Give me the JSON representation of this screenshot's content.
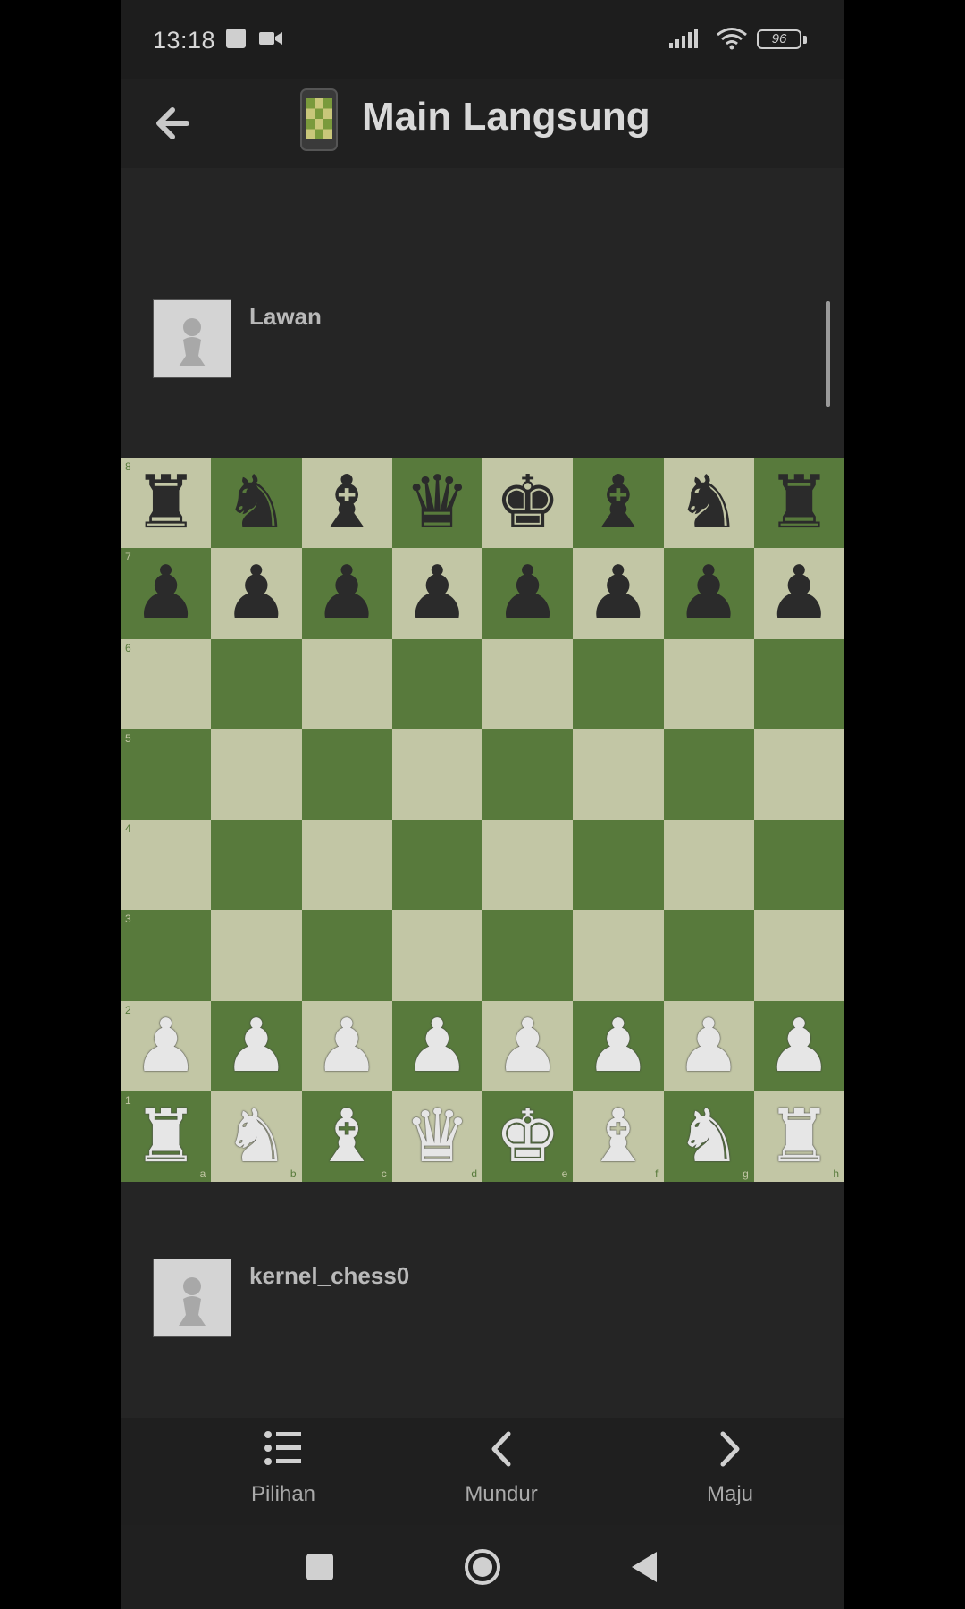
{
  "status_bar": {
    "time": "13:18",
    "battery": "96",
    "icons": [
      "shopping-bag-icon",
      "video-camera-icon",
      "signal-icon",
      "wifi-icon",
      "battery-icon"
    ]
  },
  "app_bar": {
    "title": "Main Langsung",
    "back_icon": "arrow-left-icon",
    "app_icon": "phone-board-icon"
  },
  "opponent": {
    "name": "Lawan"
  },
  "player": {
    "name": "kernel_chess0"
  },
  "board": {
    "light_color": "#c2c6a5",
    "dark_color": "#587a3c",
    "ranks": [
      "8",
      "7",
      "6",
      "5",
      "4",
      "3",
      "2",
      "1"
    ],
    "files": [
      "a",
      "b",
      "c",
      "d",
      "e",
      "f",
      "g",
      "h"
    ],
    "position": [
      [
        "r",
        "n",
        "b",
        "q",
        "k",
        "b",
        "n",
        "r"
      ],
      [
        "p",
        "p",
        "p",
        "p",
        "p",
        "p",
        "p",
        "p"
      ],
      [
        "",
        "",
        "",
        "",
        "",
        "",
        "",
        ""
      ],
      [
        "",
        "",
        "",
        "",
        "",
        "",
        "",
        ""
      ],
      [
        "",
        "",
        "",
        "",
        "",
        "",
        "",
        ""
      ],
      [
        "",
        "",
        "",
        "",
        "",
        "",
        "",
        ""
      ],
      [
        "P",
        "P",
        "P",
        "P",
        "P",
        "P",
        "P",
        "P"
      ],
      [
        "R",
        "N",
        "B",
        "Q",
        "K",
        "B",
        "N",
        "R"
      ]
    ]
  },
  "bottom_nav": {
    "options_label": "Pilihan",
    "back_label": "Mundur",
    "forward_label": "Maju"
  },
  "system_nav": [
    "recents-button",
    "home-button",
    "back-button"
  ]
}
